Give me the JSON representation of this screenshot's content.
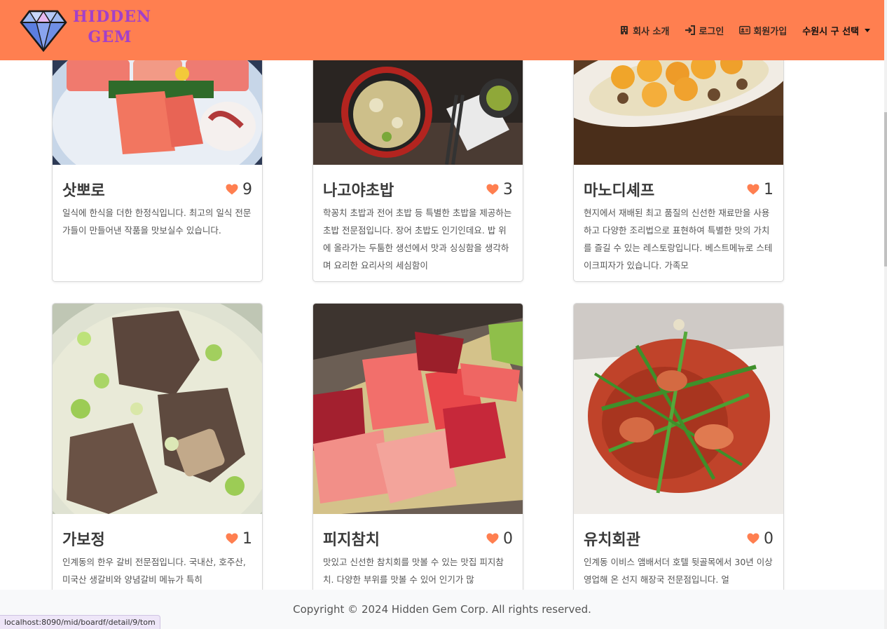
{
  "brand": {
    "line1": "HIDDEN",
    "line2": "GEM"
  },
  "nav": {
    "about": "회사 소개",
    "login": "로그인",
    "signup": "회원가입",
    "district": "수원시 구 선택"
  },
  "cards": [
    {
      "title": "삿뽀로",
      "likes": "9",
      "desc": "일식에 한식을 더한 한정식입니다. 최고의 일식 전문가들이 만들어낸 작품을 맛보실수 있습니다."
    },
    {
      "title": "나고야초밥",
      "likes": "3",
      "desc": "학꽁치 초밥과 전어 초밥 등 특별한 초밥을 제공하는 초밥 전문점입니다. 장어 초밥도 인기인데요. 밥 위에 올라가는 두툼한 생선에서 맛과 싱싱함을 생각하며 요리한 요리사의 세심함이"
    },
    {
      "title": "마노디셰프",
      "likes": "1",
      "desc": "현지에서 재배된 최고 품질의 신선한 재료만을 사용하고 다양한 조리법으로 표현하여 특별한 맛의 가치를 즐길 수 있는 레스토랑입니다. 베스트메뉴로 스테이크피자가 있습니다. 가족모"
    },
    {
      "title": "가보정",
      "likes": "1",
      "desc": "인계동의 한우 갈비 전문점입니다. 국내산, 호주산, 미국산 생갈비와 양념갈비 메뉴가 특히"
    },
    {
      "title": "피지참치",
      "likes": "0",
      "desc": "맛있고 신선한 참치회를 맛볼 수 있는 맛집 피지참치. 다양한 부위를 맛볼 수 있어 인기가 많"
    },
    {
      "title": "유치회관",
      "likes": "0",
      "desc": "인계동 이비스 앰배서더 호텔 뒷골목에서 30년 이상 영업해 온 선지 해장국 전문점입니다. 얼"
    }
  ],
  "footer": {
    "copyright": "Copyright © 2024 Hidden Gem Corp. All rights reserved."
  },
  "status_bar": {
    "url": "localhost:8090/mid/boardf/detail/9/tom"
  },
  "colors": {
    "navbar": "#ff7f50",
    "brand_text": "#a340c9",
    "heart": "#ff7f50"
  }
}
